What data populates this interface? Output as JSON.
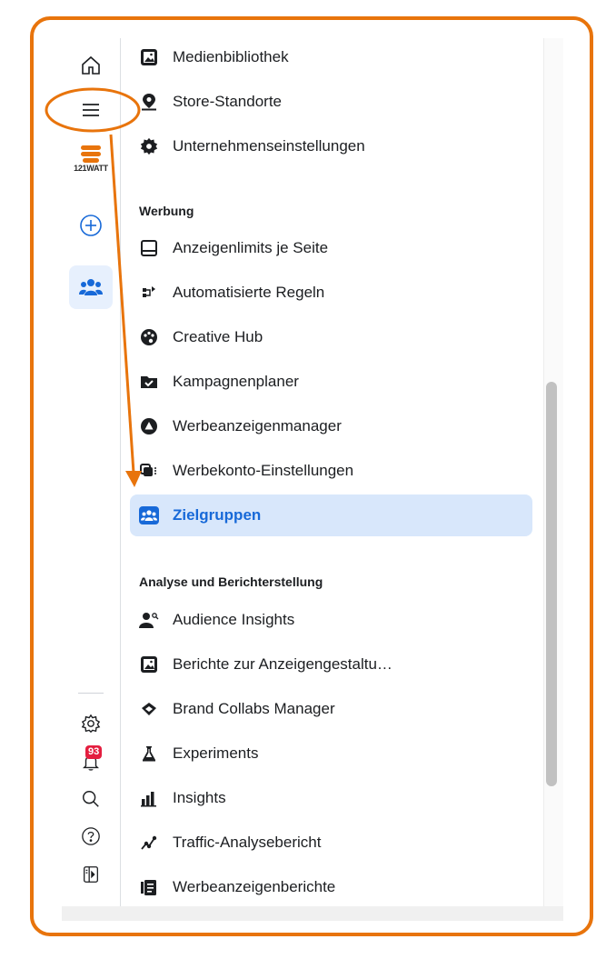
{
  "rail": {
    "items": [
      {
        "name": "home-icon"
      },
      {
        "name": "menu-icon"
      },
      {
        "name": "add-icon"
      },
      {
        "name": "audiences-icon"
      }
    ],
    "bottom": [
      {
        "name": "settings-icon"
      },
      {
        "name": "notifications-icon"
      },
      {
        "name": "search-icon"
      },
      {
        "name": "help-icon"
      },
      {
        "name": "collapse-panel-icon"
      }
    ],
    "notification_count": "93",
    "logo_text": "121WATT"
  },
  "menu": {
    "top_items": [
      {
        "label": "Medienbibliothek",
        "icon": "media-library-icon"
      },
      {
        "label": "Store-Standorte",
        "icon": "location-pin-icon"
      },
      {
        "label": "Unternehmenseinstellungen",
        "icon": "gear-icon"
      }
    ],
    "section_werbung": "Werbung",
    "werbung_items": [
      {
        "label": "Anzeigenlimits je Seite",
        "icon": "ad-limits-icon"
      },
      {
        "label": "Automatisierte Regeln",
        "icon": "rules-icon"
      },
      {
        "label": "Creative Hub",
        "icon": "palette-icon"
      },
      {
        "label": "Kampagnenplaner",
        "icon": "folder-check-icon"
      },
      {
        "label": "Werbeanzeigenmanager",
        "icon": "ads-manager-icon"
      },
      {
        "label": "Werbekonto-Einstellungen",
        "icon": "ad-account-settings-icon"
      },
      {
        "label": "Zielgruppen",
        "icon": "audiences-icon",
        "active": true
      }
    ],
    "section_analyse": "Analyse und Berichterstellung",
    "analyse_items": [
      {
        "label": "Audience Insights",
        "icon": "audience-insights-icon"
      },
      {
        "label": "Berichte zur Anzeigengestaltu…",
        "icon": "image-report-icon"
      },
      {
        "label": "Brand Collabs Manager",
        "icon": "handshake-icon"
      },
      {
        "label": "Experiments",
        "icon": "flask-icon"
      },
      {
        "label": "Insights",
        "icon": "bar-chart-icon"
      },
      {
        "label": "Traffic-Analysebericht",
        "icon": "trend-line-icon"
      },
      {
        "label": "Werbeanzeigenberichte",
        "icon": "reports-icon"
      }
    ]
  },
  "colors": {
    "accent": "#1769d8",
    "annotation": "#e8740c",
    "active_bg": "#d8e7fb"
  }
}
